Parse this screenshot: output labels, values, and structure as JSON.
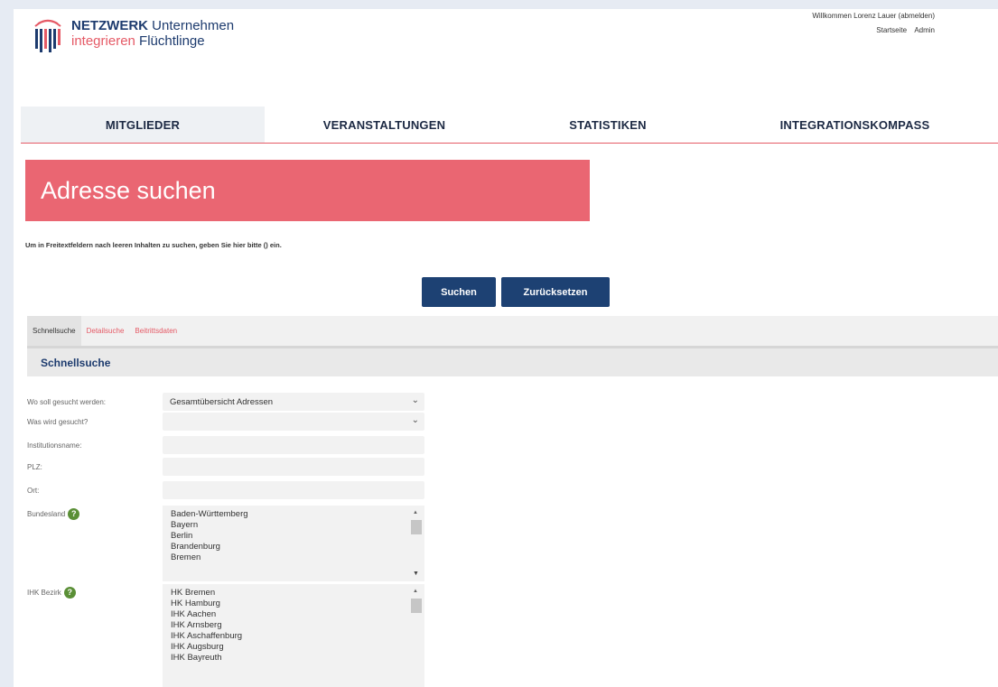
{
  "logo": {
    "line1_bold": "NETZWERK",
    "line1_rest": " Unternehmen",
    "line2_accent": "integrieren",
    "line2_rest": " Flüchtlinge"
  },
  "userbar": {
    "welcome": "Willkommen Lorenz Lauer (abmelden)",
    "links": [
      "Startseite",
      "Admin"
    ]
  },
  "nav": [
    "MITGLIEDER",
    "VERANSTALTUNGEN",
    "STATISTIKEN",
    "INTEGRATIONSKOMPASS"
  ],
  "page_title": "Adresse suchen",
  "hint": "Um in Freitextfeldern nach leeren Inhalten zu suchen, geben Sie hier bitte () ein.",
  "buttons": {
    "search": "Suchen",
    "reset": "Zurücksetzen"
  },
  "tabs": [
    "Schnellsuche",
    "Detailsuche",
    "Beitrittsdaten"
  ],
  "section_title": "Schnellsuche",
  "form": {
    "where_label": "Wo soll gesucht werden:",
    "where_value": "Gesamtübersicht Adressen",
    "what_label": "Was wird gesucht?",
    "what_value": "",
    "institution_label": "Institutionsname:",
    "plz_label": "PLZ:",
    "ort_label": "Ort:",
    "bundesland_label": "Bundesland",
    "bundesland_options": [
      "Baden-Württemberg",
      "Bayern",
      "Berlin",
      "Brandenburg",
      "Bremen"
    ],
    "ihk_label": "IHK Bezirk",
    "ihk_options": [
      "HK Bremen",
      "HK Hamburg",
      "IHK Aachen",
      "IHK Arnsberg",
      "IHK Aschaffenburg",
      "IHK Augsburg",
      "IHK Bayreuth"
    ]
  },
  "colors": {
    "accent": "#ea6672",
    "navy": "#1d4173",
    "help": "#5a8f36"
  },
  "icons": {
    "help": "question-mark-icon",
    "select": "chevron-down-icon",
    "logo": "logo-mark-icon"
  }
}
